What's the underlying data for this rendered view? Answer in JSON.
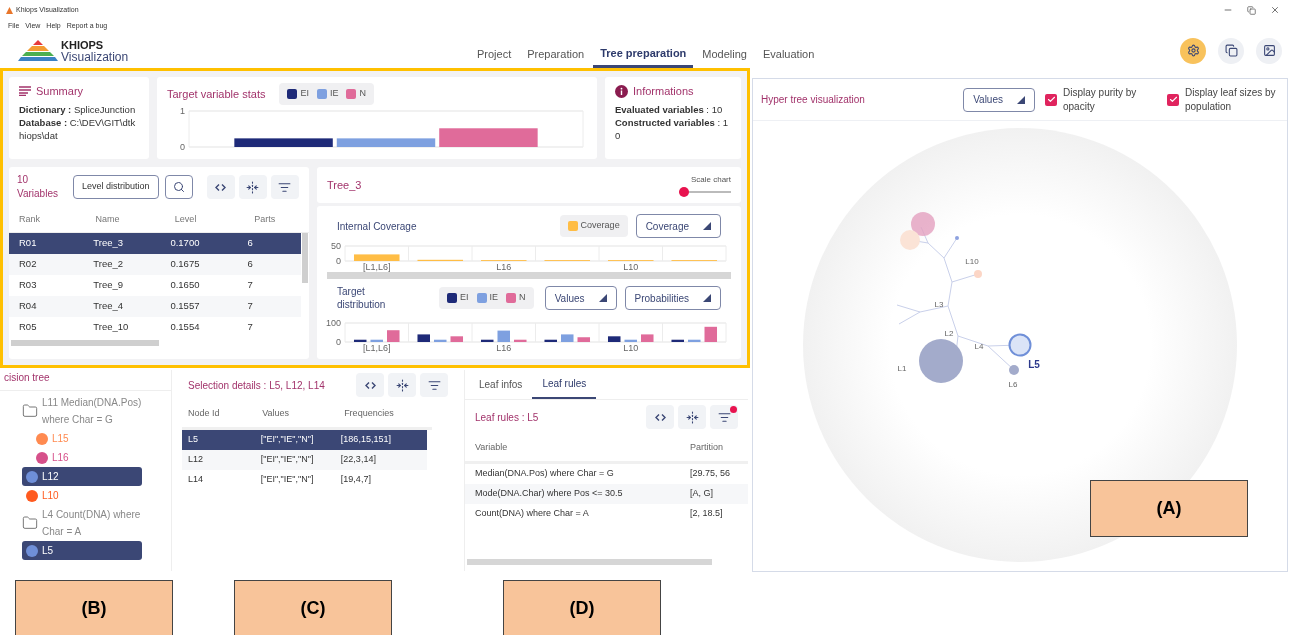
{
  "window": {
    "title": "Khiops Visualization"
  },
  "menu": [
    "File",
    "View",
    "Help",
    "Report a bug"
  ],
  "logo": {
    "title": "KHIOPS",
    "subtitle": "Visualization"
  },
  "nav": [
    {
      "label": "Project",
      "selected": false
    },
    {
      "label": "Preparation",
      "selected": false
    },
    {
      "label": "Tree preparation",
      "selected": true
    },
    {
      "label": "Modeling",
      "selected": false
    },
    {
      "label": "Evaluation",
      "selected": false
    }
  ],
  "summary": {
    "title": "Summary",
    "lines": [
      "**Dictionary :** SpliceJunction",
      "**Database :** C:\\DEV\\GIT\\dtkhiops\\dat"
    ]
  },
  "target_stats": {
    "title": "Target variable stats",
    "chart_data": {
      "type": "bar",
      "series": [
        {
          "name": "EI",
          "color": "#1e2a78",
          "values": [
            0.24
          ]
        },
        {
          "name": "IE",
          "color": "#7ea0e0",
          "values": [
            0.24
          ]
        },
        {
          "name": "N",
          "color": "#e06b9a",
          "values": [
            0.52
          ]
        }
      ],
      "ylim": [
        0,
        1
      ],
      "yticks": [
        0,
        1
      ]
    }
  },
  "informations": {
    "title": "Informations",
    "lines": [
      "**Evaluated variables** : 10",
      "**Constructed variables** : 10"
    ]
  },
  "variables": {
    "title": "10 Variables",
    "button": "Level distribution",
    "columns": [
      "Rank",
      "Name",
      "Level",
      "Parts"
    ],
    "rows": [
      {
        "cells": [
          "R01",
          "Tree_3",
          "0.1700",
          "6"
        ],
        "selected": true
      },
      {
        "cells": [
          "R02",
          "Tree_2",
          "0.1675",
          "6"
        ],
        "selected": false
      },
      {
        "cells": [
          "R03",
          "Tree_9",
          "0.1650",
          "7"
        ],
        "selected": false
      },
      {
        "cells": [
          "R04",
          "Tree_4",
          "0.1557",
          "7"
        ],
        "selected": false
      },
      {
        "cells": [
          "R05",
          "Tree_10",
          "0.1554",
          "7"
        ],
        "selected": false
      }
    ]
  },
  "tree_chart": {
    "title": "Tree_3",
    "scale": {
      "label": "Scale chart",
      "level": 0
    },
    "coverage": {
      "title": "Internal Coverage",
      "dropdown": "Coverage",
      "chart_data": {
        "type": "bar",
        "categories": [
          "[L1,L6]",
          null,
          "L16",
          null,
          "L10",
          null
        ],
        "series": [
          {
            "name": "Coverage",
            "color": "#ffbd45",
            "values": [
              22,
              4,
              3,
              3,
              3,
              3
            ]
          }
        ],
        "ylim": [
          0,
          50
        ],
        "yticks": [
          0,
          50
        ]
      }
    },
    "distribution": {
      "title": "Target distribution",
      "dropdowns": [
        "Values",
        "Probabilities"
      ],
      "chart_data": {
        "type": "bar",
        "stacked": false,
        "categories": [
          "[L1,L6]",
          null,
          "L16",
          null,
          "L10",
          null
        ],
        "series": [
          {
            "name": "EI",
            "color": "#1e2a78",
            "values": [
              12,
              40,
              12,
              12,
              30,
              12
            ]
          },
          {
            "name": "IE",
            "color": "#7ea0e0",
            "values": [
              12,
              12,
              60,
              40,
              12,
              12
            ]
          },
          {
            "name": "N",
            "color": "#e06b9a",
            "values": [
              62,
              30,
              12,
              25,
              40,
              80
            ]
          }
        ],
        "ylim": [
          0,
          100
        ],
        "yticks": [
          0,
          100
        ]
      }
    }
  },
  "decision_tree": {
    "title": "cision tree",
    "items": [
      {
        "kind": "folder",
        "label": "L11 Median(DNA.Pos) where Char = G",
        "children": [
          {
            "kind": "leaf",
            "label": "L15",
            "color": "#ff8a50",
            "selected": false
          },
          {
            "kind": "leaf",
            "label": "L16",
            "color": "#d6508a",
            "selected": false
          }
        ]
      },
      {
        "kind": "leaf",
        "label": "L12",
        "color": "#6f8fd8",
        "selected": true
      },
      {
        "kind": "leaf",
        "label": "L10",
        "color": "#ff5a1f",
        "selected": false
      },
      {
        "kind": "folder",
        "label": "L4 Count(DNA) where Char = A"
      },
      {
        "kind": "leaf",
        "label": "L5",
        "color": "#6f8fd8",
        "selected": true
      }
    ]
  },
  "selection": {
    "title": "Selection details : L5, L12, L14",
    "columns": [
      "Node Id",
      "Values",
      "Frequencies"
    ],
    "rows": [
      {
        "cells": [
          "L5",
          "[\"EI\",\"IE\",\"N\"]",
          "[186,15,151]"
        ],
        "selected": true
      },
      {
        "cells": [
          "L12",
          "[\"EI\",\"IE\",\"N\"]",
          "[22,3,14]"
        ],
        "selected": false
      },
      {
        "cells": [
          "L14",
          "[\"EI\",\"IE\",\"N\"]",
          "[19,4,7]"
        ],
        "selected": false
      }
    ]
  },
  "leaf": {
    "tabs": [
      {
        "label": "Leaf infos",
        "selected": false
      },
      {
        "label": "Leaf rules",
        "selected": true
      }
    ],
    "title": "Leaf rules : L5",
    "filter_active": true,
    "columns": [
      "Variable",
      "Partition"
    ],
    "rows": [
      [
        "Median(DNA.Pos) where Char = G",
        "[29.75, 56"
      ],
      [
        "Mode(DNA.Char) where Pos <= 30.5",
        "[A, G]"
      ],
      [
        "Count(DNA) where Char = A",
        "[2, 18.5]"
      ]
    ]
  },
  "hyper_tree": {
    "title": "Hyper tree visualization",
    "dropdown": "Values",
    "options": [
      {
        "label": "Display purity by opacity",
        "checked": true
      },
      {
        "label": "Display leaf sizes by population",
        "checked": true
      }
    ],
    "nodes": [
      {
        "label": "L10",
        "selected": false
      },
      {
        "label": "L3",
        "selected": false
      },
      {
        "label": "L2",
        "selected": false
      },
      {
        "label": "L4",
        "selected": false
      },
      {
        "label": "L1",
        "selected": false
      },
      {
        "label": "L5",
        "selected": true
      },
      {
        "label": "L6",
        "selected": false
      }
    ]
  },
  "annotations": [
    "(A)",
    "(B)",
    "(C)",
    "(D)"
  ]
}
